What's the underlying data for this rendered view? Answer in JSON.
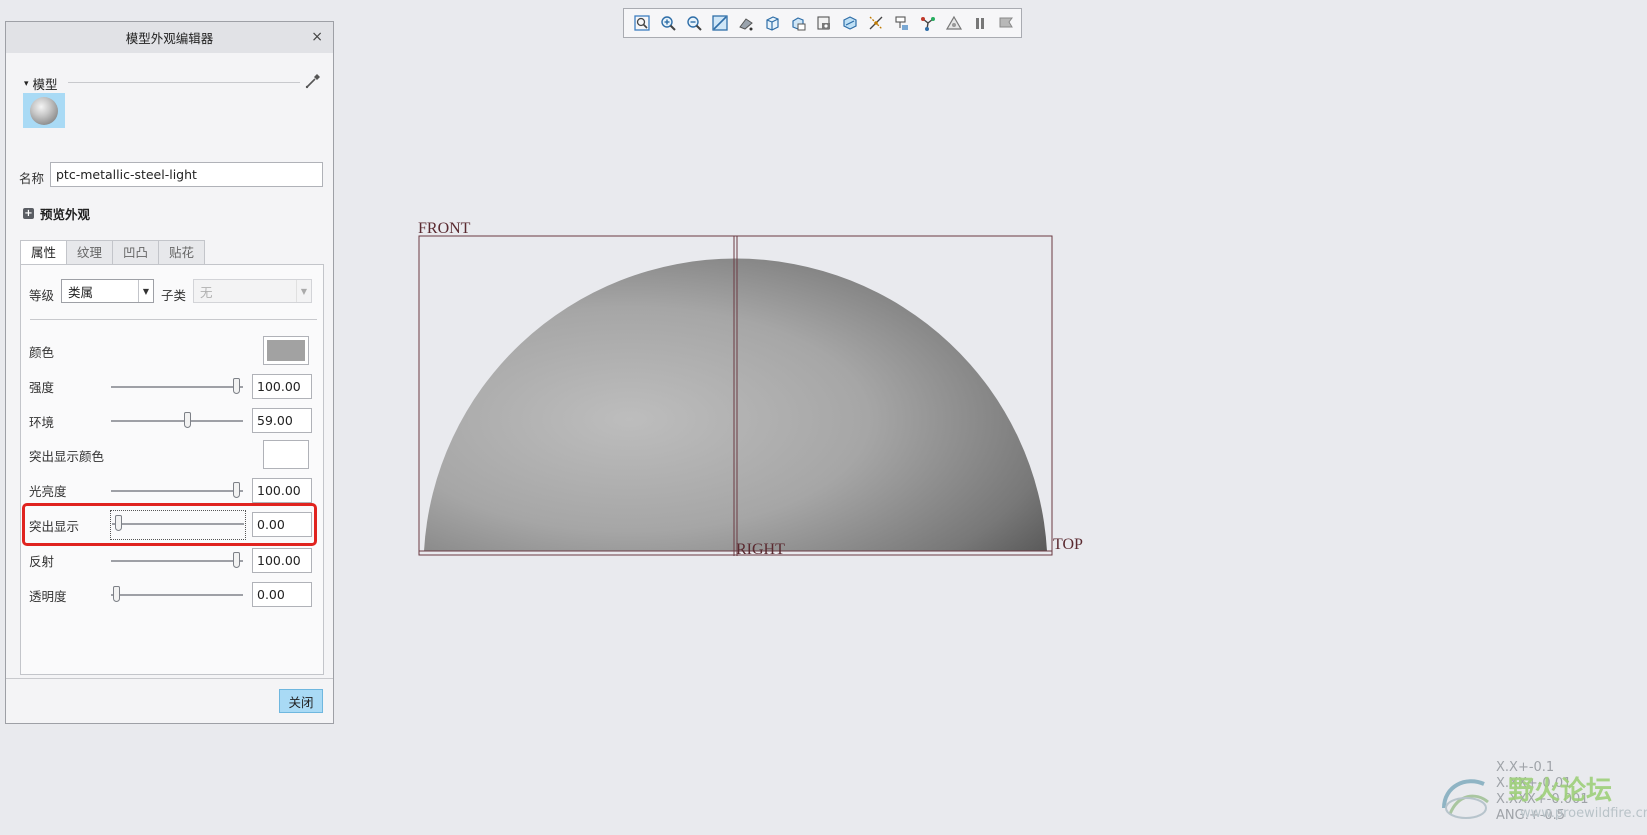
{
  "toolbar": {
    "icons": [
      "refit-icon",
      "zoom-in-icon",
      "zoom-out-icon",
      "repaint-icon",
      "perspective-icon",
      "display-style-icon",
      "saved-orientations-icon",
      "view-manager-icon",
      "section-icon",
      "datum-display-icon",
      "annotation-display-icon",
      "spin-center-icon",
      "triangle-icon",
      "pause-icon",
      "flag-icon"
    ]
  },
  "dialog": {
    "title": "模型外观编辑器",
    "close_symbol": "×",
    "section_label": "模型",
    "name_label": "名称",
    "name_value": "ptc-metallic-steel-light",
    "preview_label": "预览外观",
    "tabs": [
      "属性",
      "纹理",
      "凹凸",
      "贴花"
    ],
    "class_label": "等级",
    "class_value": "类属",
    "subclass_label": "子类",
    "subclass_value": "无",
    "color_label": "颜色",
    "color_value": "#a2a2a2",
    "intensity_label": "强度",
    "intensity_value": "100.00",
    "ambient_label": "环境",
    "ambient_value": "59.00",
    "highlight_color_label": "突出显示颜色",
    "highlight_color_value": "#ffffff",
    "shininess_label": "光亮度",
    "shininess_value": "100.00",
    "highlight_label": "突出显示",
    "highlight_value": "0.00",
    "reflection_label": "反射",
    "reflection_value": "100.00",
    "transparency_label": "透明度",
    "transparency_value": "0.00",
    "close_label": "关闭"
  },
  "viewport": {
    "datum_front": "FRONT",
    "datum_right": "RIGHT",
    "datum_top": "TOP",
    "tolerances": [
      "X.X+-0.1",
      "X.XX+-0.01",
      "X.XXX+-0.001",
      "ANG.+-0.5"
    ],
    "watermark_text": "野火论坛",
    "watermark_url": "www.proewildfire.cn"
  }
}
